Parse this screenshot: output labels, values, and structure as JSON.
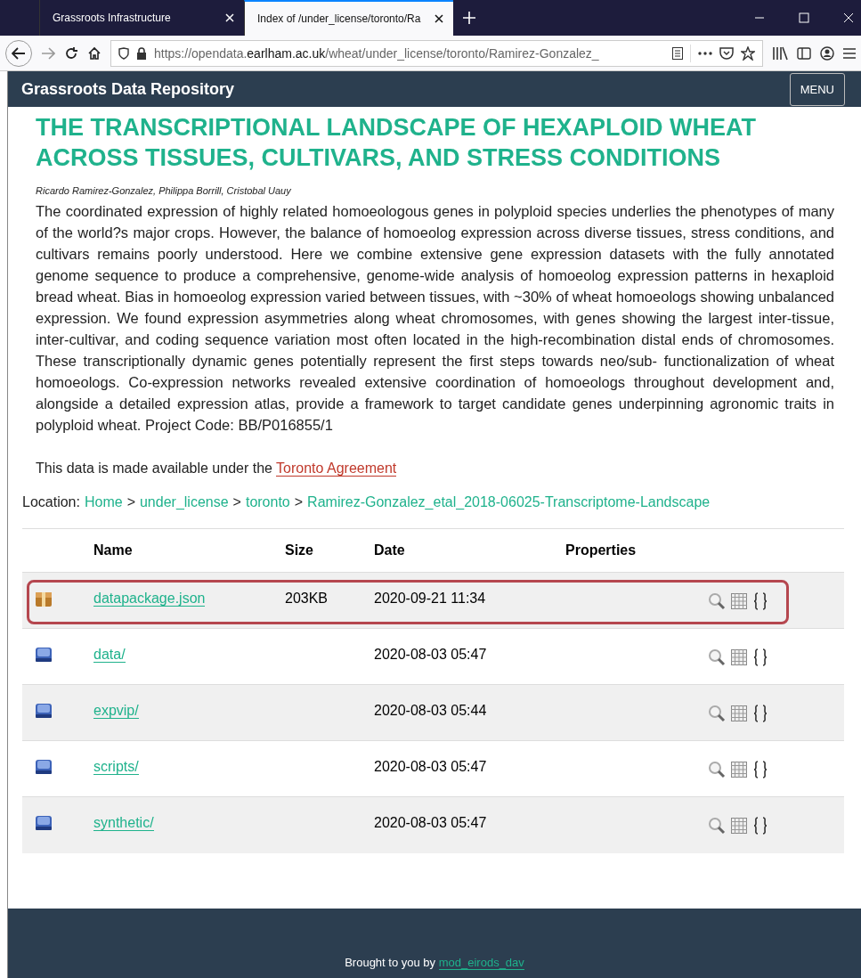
{
  "browser": {
    "tabs": [
      {
        "title": "Grassroots Infrastructure",
        "selected": false
      },
      {
        "title": "Index of /under_license/toronto/Ra",
        "selected": true
      }
    ],
    "url": "https://opendata.**earlham.ac.uk**/wheat/under_license/toronto/Ramirez-Gonzalez_"
  },
  "site_header": {
    "title": "Grassroots Data Repository",
    "menu_button": "MENU"
  },
  "article": {
    "title": "THE TRANSCRIPTIONAL LANDSCAPE OF HEXAPLOID WHEAT ACROSS TISSUES, CULTIVARS, AND STRESS CONDITIONS",
    "authors": "Ricardo Ramirez-Gonzalez, Philippa Borrill, Cristobal Uauy",
    "abstract": "The coordinated expression of highly related homoeologous genes in polyploid species underlies the phenotypes of many of the world?s major crops. However, the balance of homoeolog expression across diverse tissues, stress conditions, and cultivars remains poorly understood. Here we combine extensive gene expression datasets with the fully annotated genome sequence to produce a comprehensive, genome-wide analysis of homoeolog expression patterns in hexaploid bread wheat. Bias in homoeolog expression varied between tissues, with ~30% of wheat homoeologs showing unbalanced expression. We found expression asymmetries along wheat chromosomes, with genes showing the largest inter-tissue, inter-cultivar, and coding sequence variation most often located in the high-recombination distal ends of chromosomes. These transcriptionally dynamic genes potentially represent the first steps towards neo/sub- functionalization of wheat homoeologs. Co-expression networks revealed extensive coordination of homoeologs throughout development and, alongside a detailed expression atlas, provide a framework to target candidate genes underpinning agronomic traits in polyploid wheat. Project Code: BB/P016855/1",
    "license_text": "This data is made available under the",
    "license_link": "Toronto Agreement"
  },
  "location": {
    "label": "Location:",
    "crumbs": [
      "Home",
      "under_license",
      "toronto",
      "Ramirez-Gonzalez_etal_2018-06025-Transcriptome-Landscape"
    ],
    "separator": ">"
  },
  "table": {
    "columns": [
      "Name",
      "Size",
      "Date",
      "Properties"
    ],
    "rows": [
      {
        "kind": "file",
        "name": "datapackage.json",
        "size": "203KB",
        "date": "2020-09-21 11:34",
        "highlighted": true
      },
      {
        "kind": "folder",
        "name": "data/",
        "date": "2020-08-03 05:47",
        "highlighted": false
      },
      {
        "kind": "folder",
        "name": "expvip/",
        "date": "2020-08-03 05:44",
        "highlighted": false
      },
      {
        "kind": "folder",
        "name": "scripts/",
        "date": "2020-08-03 05:47",
        "highlighted": false
      },
      {
        "kind": "folder",
        "name": "synthetic/",
        "date": "2020-08-03 05:47",
        "highlighted": false
      }
    ]
  },
  "footer": {
    "text": "Brought to you by",
    "link": "mod_eirods_dav"
  }
}
